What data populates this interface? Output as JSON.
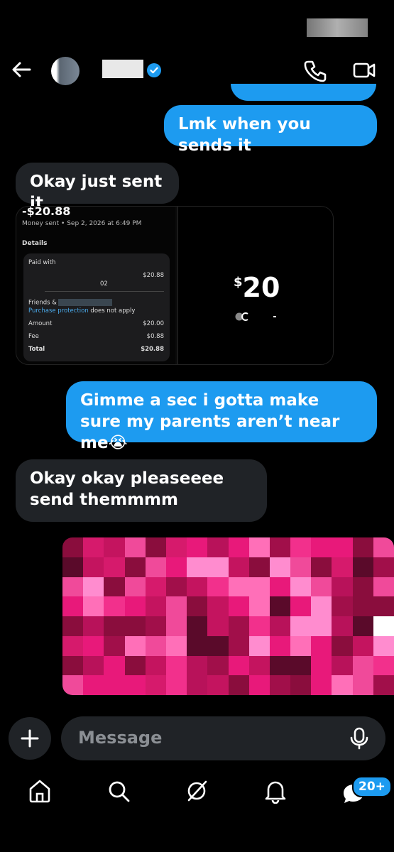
{
  "colors": {
    "accent": "#1d9bf0",
    "incoming": "#202327",
    "background": "#000000"
  },
  "header": {
    "back_icon": "arrow-left-icon",
    "verified_icon": "verified-badge-icon",
    "call_icon": "phone-icon",
    "video_icon": "video-camera-icon"
  },
  "messages": [
    {
      "direction": "out",
      "text": "Lmk when you sends it"
    },
    {
      "direction": "in",
      "text": "Okay just sent it"
    },
    {
      "direction": "out",
      "text": "Gimme a sec i gotta make sure my parents aren’t near me😭"
    },
    {
      "direction": "in",
      "text": "Okay okay pleaseeee send themmmm"
    }
  ],
  "receipt": {
    "amount": "-$20.88",
    "meta": "Money sent • Sep 2, 2026 at 6:49 PM",
    "details_label": "Details",
    "paid_with_label": "Paid with",
    "paid_with_value": "$20.88",
    "card_suffix": "02",
    "friends_label": "Friends &",
    "protection_link": "Purchase protection",
    "protection_text": " does not apply",
    "amount_label": "Amount",
    "amount_value": "$20.00",
    "fee_label": "Fee",
    "fee_value": "$0.88",
    "total_label": "Total",
    "total_value": "$20.88",
    "big_amount_currency": "$",
    "big_amount_number": "20"
  },
  "composer": {
    "placeholder": "Message",
    "plus_icon": "plus-icon",
    "mic_icon": "microphone-icon"
  },
  "bottom_nav": {
    "items": [
      "home-icon",
      "search-icon",
      "grok-icon",
      "notifications-bell-icon",
      "messages-icon"
    ],
    "badge": "20+"
  }
}
